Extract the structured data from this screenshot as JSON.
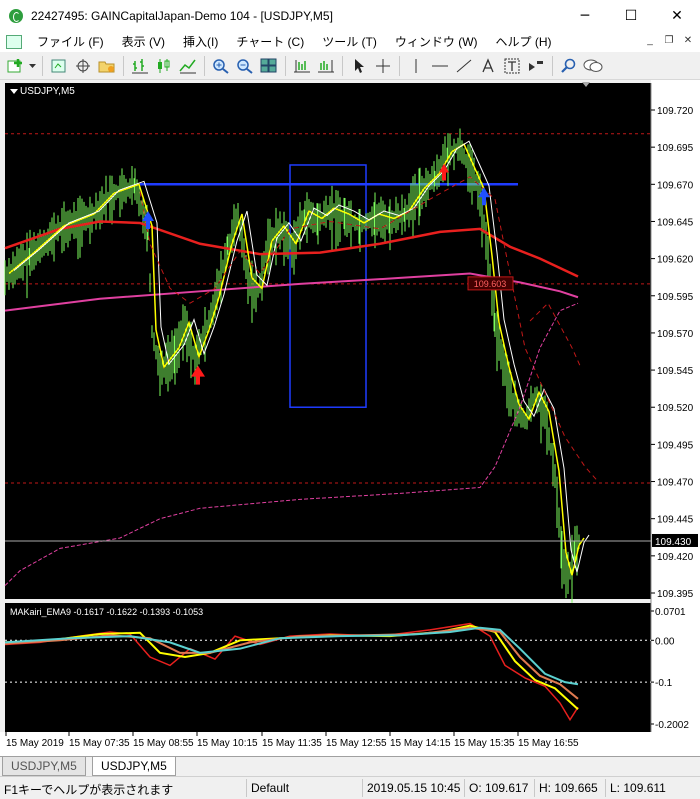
{
  "window": {
    "title": "22427495: GAINCapitalJapan-Demo 104 - [USDJPY,M5]",
    "minimize": "─",
    "maximize": "☐",
    "close": "✕"
  },
  "menu": {
    "items": [
      "ファイル (F)",
      "表示 (V)",
      "挿入(I)",
      "チャート (C)",
      "ツール (T)",
      "ウィンドウ (W)",
      "ヘルプ (H)"
    ],
    "mdi_minimize": "_",
    "mdi_restore": "❐",
    "mdi_close": "✕"
  },
  "chart": {
    "symbol_label": "USDJPY,M5",
    "price_labels": [
      "109.720",
      "109.695",
      "109.670",
      "109.645",
      "109.620",
      "109.595",
      "109.570",
      "109.545",
      "109.520",
      "109.495",
      "109.470",
      "109.445",
      "109.420",
      "109.395"
    ],
    "current_price": "109.430",
    "price_tag": "109.603",
    "indicator_label": "MAKairi_EMA9 -0.1617 -0.1622 -0.1393 -0.1053",
    "indicator_levels": [
      "0.0701",
      "0.00",
      "-0.1",
      "-0.2002"
    ],
    "time_labels": [
      "15 May 2019",
      "15 May 07:35",
      "15 May 08:55",
      "15 May 10:15",
      "15 May 11:35",
      "15 May 12:55",
      "15 May 14:15",
      "15 May 15:35",
      "15 May 16:55"
    ],
    "colors": {
      "background": "#000000",
      "candles": "#7cfc5c",
      "ema_fast": "#ffff00",
      "ema_slow": "#ffffff",
      "ma_red": "#e8201e",
      "ma_magenta": "#e040a0",
      "hline_blue": "#1f3cff",
      "box_blue": "#1f3cff",
      "dashed_red": "#c01818"
    }
  },
  "tabs": [
    "USDJPY,M5",
    "USDJPY,M5"
  ],
  "status": {
    "help": "F1キーでヘルプが表示されます",
    "profile": "Default",
    "datetime": "2019.05.15 10:45",
    "open": "O: 109.617",
    "high": "H: 109.665",
    "low": "L: 109.611"
  }
}
